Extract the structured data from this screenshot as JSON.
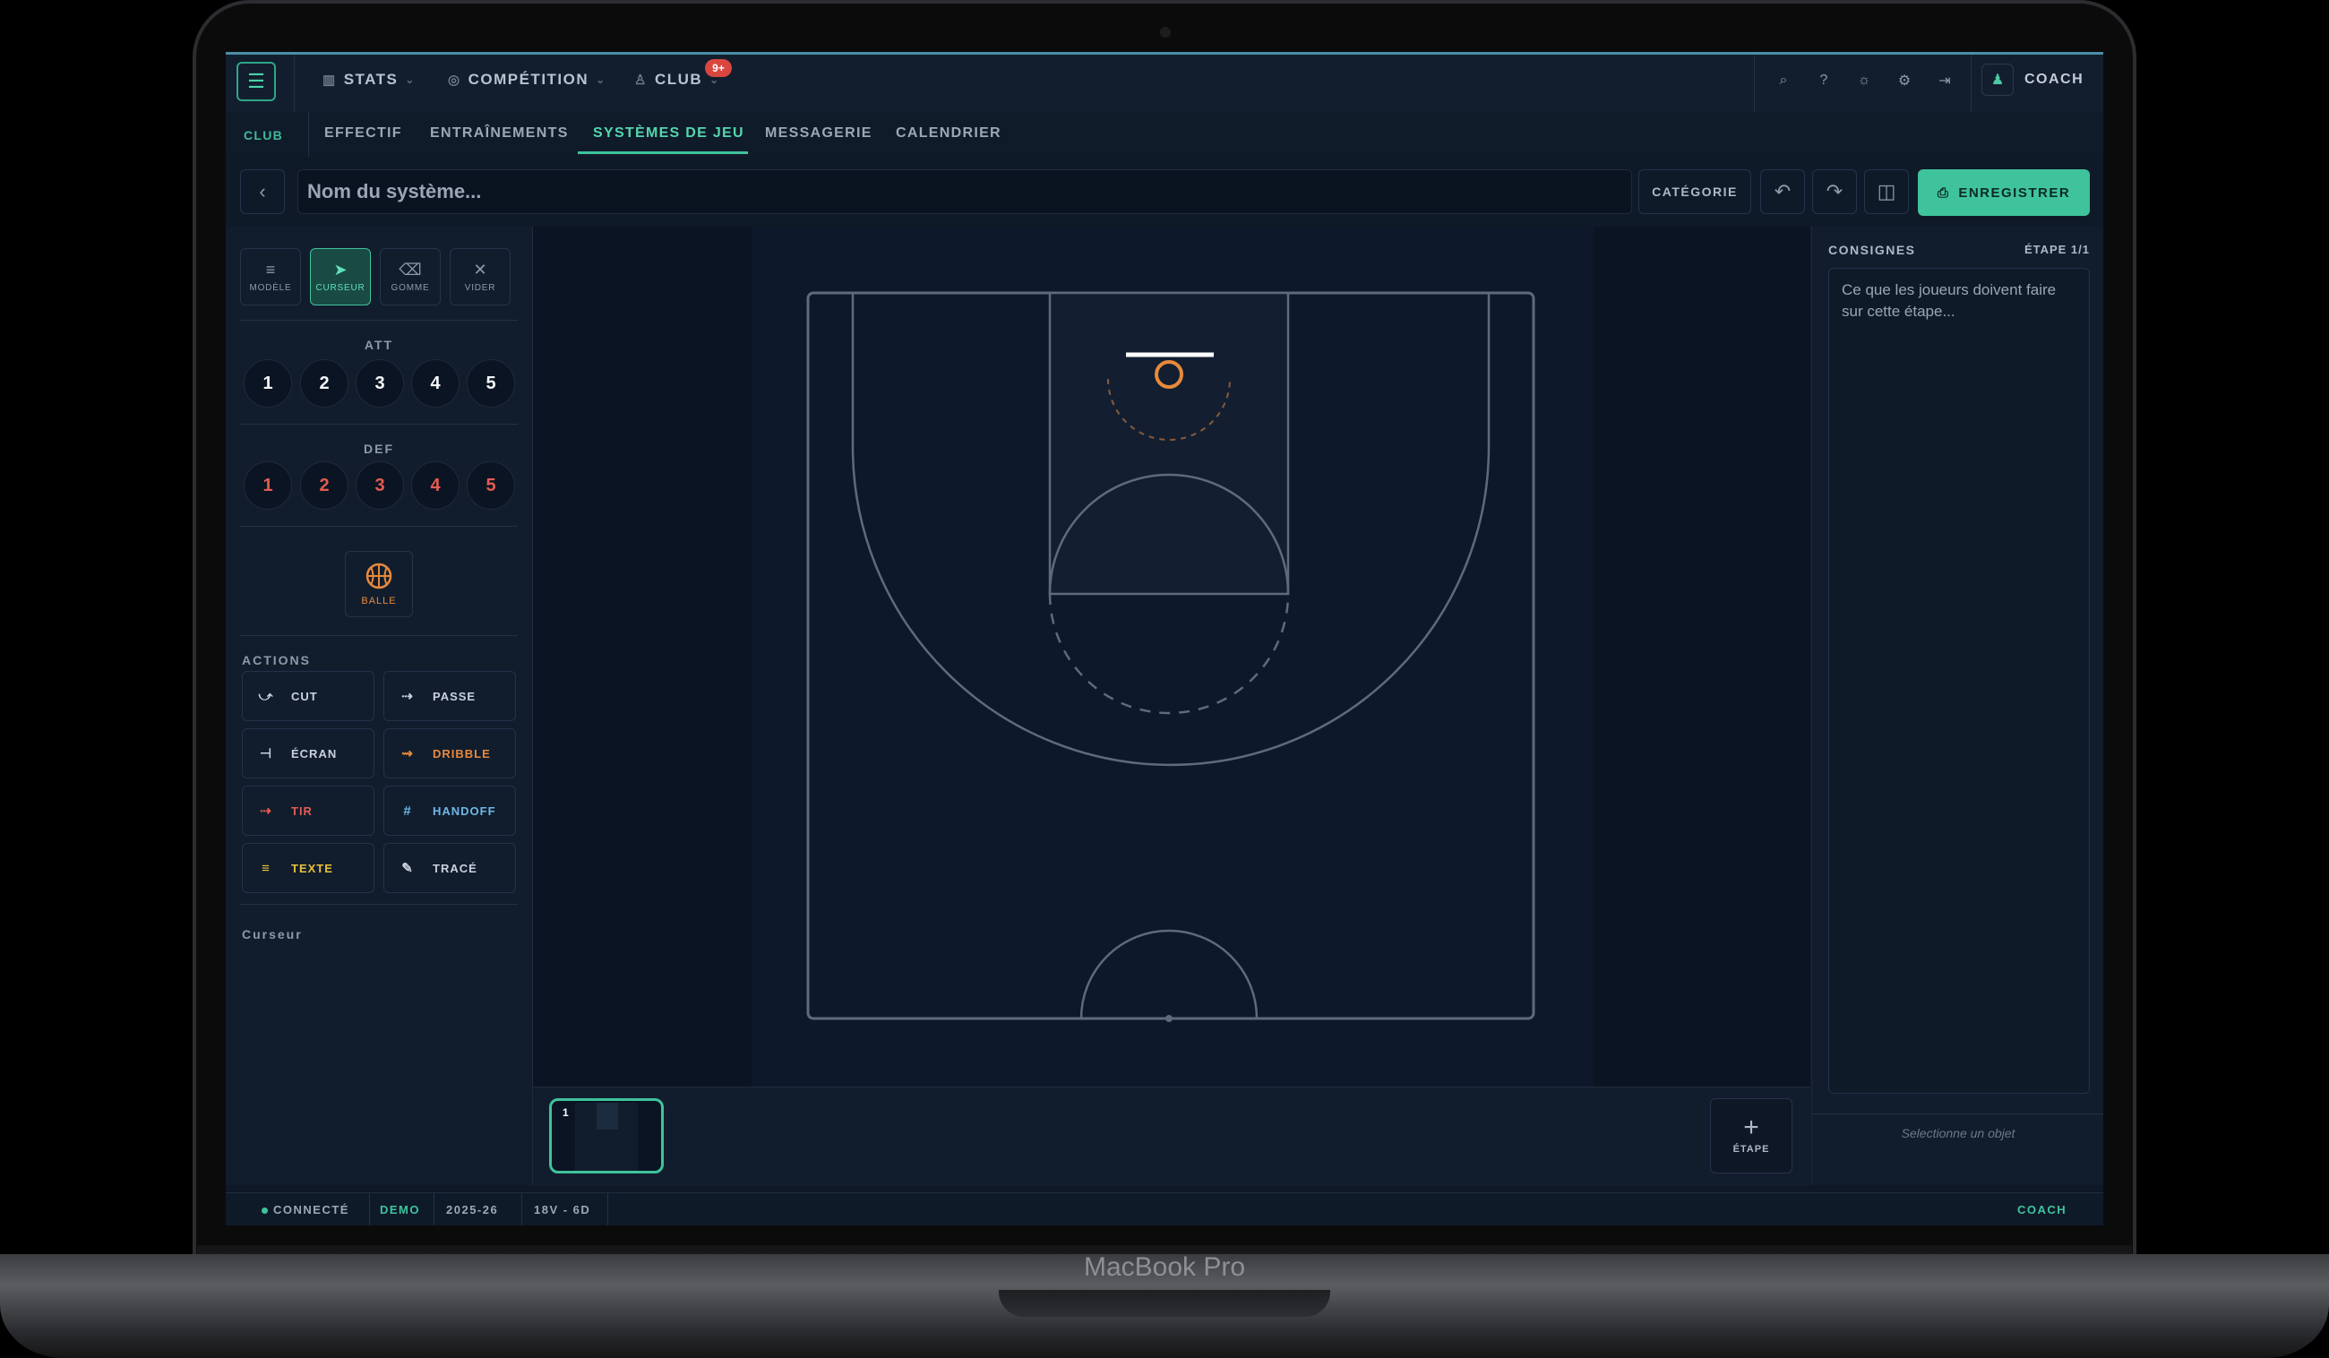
{
  "device": {
    "brand": "MacBook Pro"
  },
  "topnav": {
    "items": [
      {
        "label": "STATS",
        "icon": "bar-chart-icon"
      },
      {
        "label": "COMPÉTITION",
        "icon": "trophy-icon"
      },
      {
        "label": "CLUB",
        "icon": "users-icon"
      }
    ],
    "club_badge": "9+",
    "user_label": "COACH"
  },
  "subnav": {
    "section": "CLUB",
    "tabs": [
      "EFFECTIF",
      "ENTRAÎNEMENTS",
      "SYSTÈMES DE JEU",
      "MESSAGERIE",
      "CALENDRIER"
    ],
    "active_tab": "SYSTÈMES DE JEU"
  },
  "toolbar": {
    "name_placeholder": "Nom du système...",
    "category_label": "CATÉGORIE",
    "save_label": "ENREGISTRER"
  },
  "tools": [
    {
      "label": "MODÈLE",
      "icon": "lines-icon"
    },
    {
      "label": "CURSEUR",
      "icon": "cursor-icon",
      "active": true
    },
    {
      "label": "GOMME",
      "icon": "eraser-icon"
    },
    {
      "label": "VIDER",
      "icon": "close-icon"
    }
  ],
  "attack": {
    "label": "ATT",
    "players": [
      "1",
      "2",
      "3",
      "4",
      "5"
    ]
  },
  "defense": {
    "label": "DEF",
    "players": [
      "1",
      "2",
      "3",
      "4",
      "5"
    ]
  },
  "ball": {
    "label": "BALLE"
  },
  "actions": {
    "label": "ACTIONS",
    "items": [
      {
        "label": "CUT",
        "color": "#c8d2de"
      },
      {
        "label": "PASSE",
        "color": "#c8d2de"
      },
      {
        "label": "ÉCRAN",
        "color": "#c8d2de"
      },
      {
        "label": "DRIBBLE",
        "color": "#e8893b"
      },
      {
        "label": "TIR",
        "color": "#e45b52"
      },
      {
        "label": "HANDOFF",
        "color": "#6fb7e8"
      },
      {
        "label": "TEXTE",
        "color": "#e8c23b"
      },
      {
        "label": "TRACÉ",
        "color": "#c8d2de"
      }
    ]
  },
  "current_tool": "Curseur",
  "steps": {
    "items": [
      "1"
    ],
    "add_label": "ÉTAPE"
  },
  "instructions": {
    "title": "CONSIGNES",
    "step": "ÉTAPE 1/1",
    "placeholder": "Ce que les joueurs doivent faire sur cette étape...",
    "footer": "Selectionne un objet"
  },
  "statusbar": {
    "connection": "CONNECTÉ",
    "mode": "DEMO",
    "season": "2025-26",
    "record": "18V - 6D",
    "role": "COACH"
  },
  "colors": {
    "accent": "#3fc39c",
    "attack": "#f3f6f9",
    "defense": "#e45b52",
    "ball": "#e8893b"
  }
}
